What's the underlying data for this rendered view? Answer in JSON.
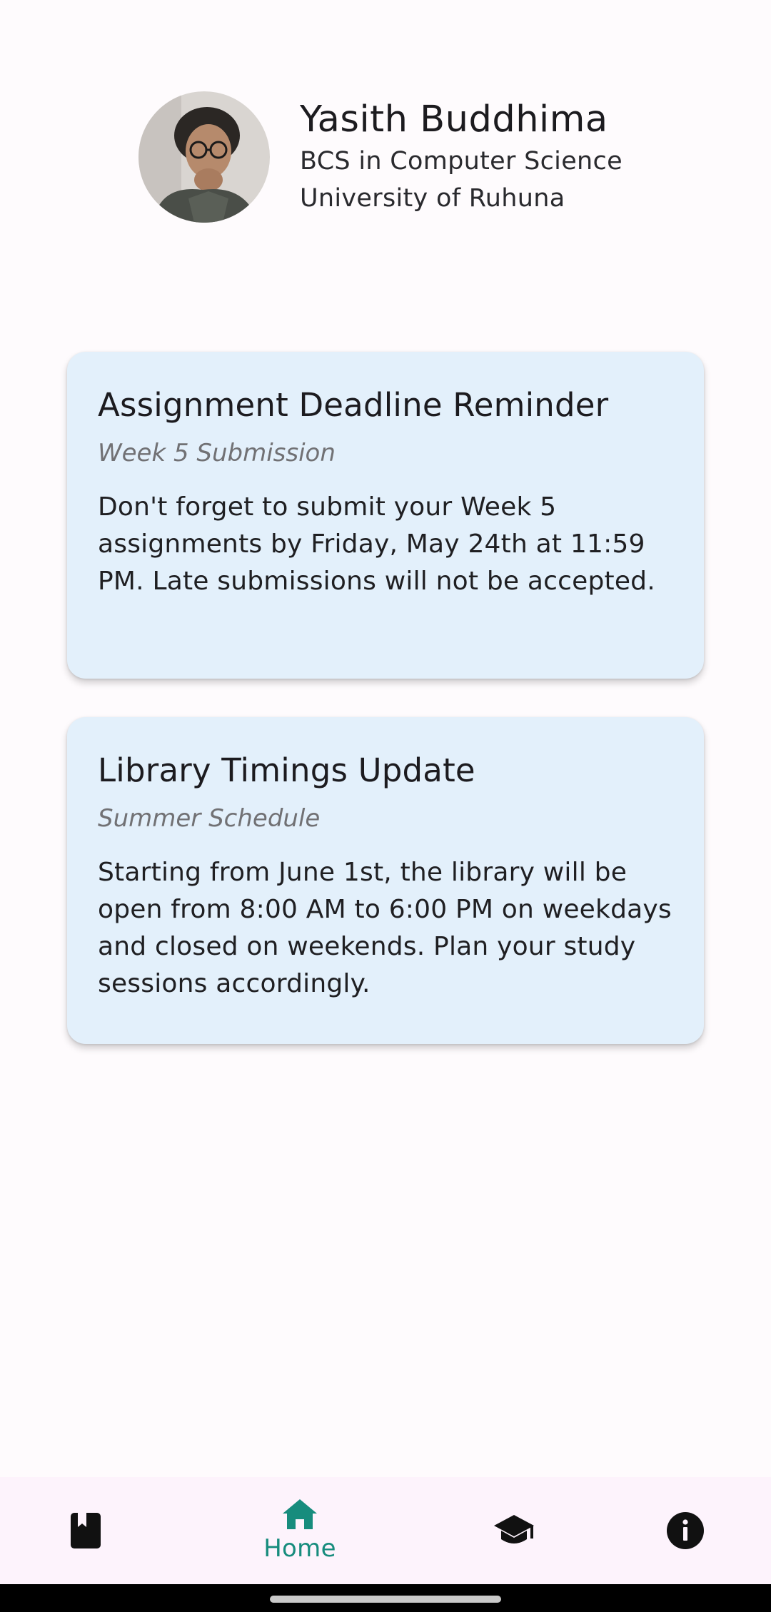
{
  "profile": {
    "name": "Yasith Buddhima",
    "degree": "BCS in Computer Science",
    "university": "University of Ruhuna",
    "avatar_icon": "profile-photo"
  },
  "announcements": [
    {
      "title": "Assignment Deadline Reminder",
      "subtitle": "Week 5 Submission",
      "body": "Don't forget to submit your Week 5 assignments by Friday, May 24th at 11:59 PM. Late submissions will not be accepted."
    },
    {
      "title": "Library Timings Update",
      "subtitle": "Summer Schedule",
      "body": "Starting from June 1st, the library will be open from 8:00 AM to 6:00 PM on weekdays and closed on weekends. Plan your study sessions accordingly."
    }
  ],
  "bottom_nav": {
    "items": [
      {
        "icon": "book-icon",
        "label": "",
        "active": false
      },
      {
        "icon": "home-icon",
        "label": "Home",
        "active": true
      },
      {
        "icon": "graduation-cap-icon",
        "label": "",
        "active": false
      },
      {
        "icon": "info-icon",
        "label": "",
        "active": false
      }
    ]
  },
  "colors": {
    "background": "#fefbfd",
    "card_background": "#e3f0fb",
    "nav_background": "#fdf3fc",
    "accent": "#178c7d",
    "subtitle_text": "#717174"
  }
}
